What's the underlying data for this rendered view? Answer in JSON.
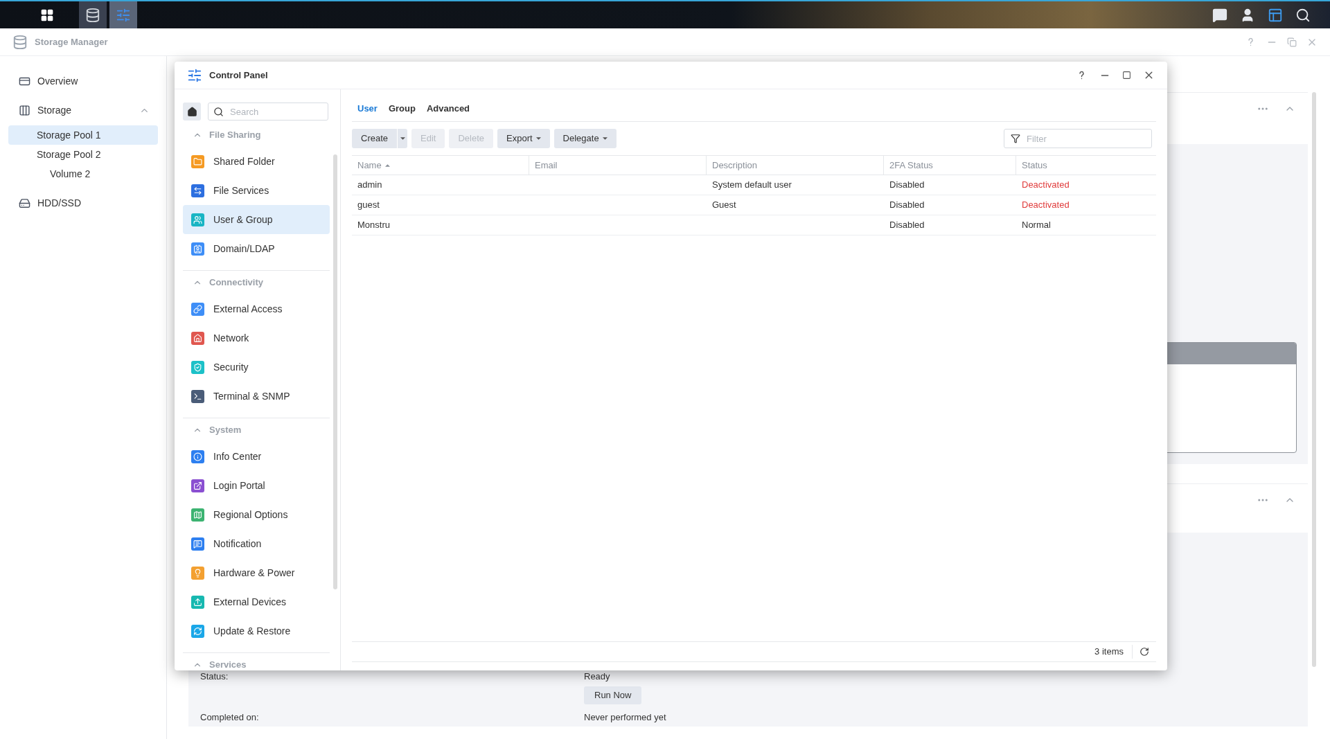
{
  "taskbar": {
    "apps": [
      {
        "selected": false
      },
      {
        "selected": true
      }
    ]
  },
  "storage_manager": {
    "title": "Storage Manager",
    "sidebar": [
      {
        "label": "Overview",
        "selected": false
      },
      {
        "label": "Storage",
        "selected": false,
        "expanded": true,
        "children": [
          {
            "label": "Storage Pool 1",
            "selected": true
          },
          {
            "label": "Storage Pool 2",
            "selected": false,
            "children": [
              {
                "label": "Volume 2",
                "selected": false
              }
            ]
          }
        ]
      },
      {
        "label": "HDD/SSD",
        "selected": false
      }
    ],
    "details": [
      {
        "label": "Status:",
        "value": "Ready",
        "button": "Run Now"
      },
      {
        "label": "Completed on:",
        "value": "Never performed yet"
      }
    ]
  },
  "control_panel": {
    "title": "Control Panel",
    "search": {
      "placeholder": "Search"
    },
    "sections": [
      {
        "title": "File Sharing",
        "expanded": true,
        "items": [
          {
            "label": "Shared Folder",
            "selected": false
          },
          {
            "label": "File Services",
            "selected": false
          },
          {
            "label": "User & Group",
            "selected": true
          },
          {
            "label": "Domain/LDAP",
            "selected": false
          }
        ]
      },
      {
        "title": "Connectivity",
        "expanded": true,
        "items": [
          {
            "label": "External Access",
            "selected": false
          },
          {
            "label": "Network",
            "selected": false
          },
          {
            "label": "Security",
            "selected": false
          },
          {
            "label": "Terminal & SNMP",
            "selected": false
          }
        ]
      },
      {
        "title": "System",
        "expanded": true,
        "items": [
          {
            "label": "Info Center",
            "selected": false
          },
          {
            "label": "Login Portal",
            "selected": false
          },
          {
            "label": "Regional Options",
            "selected": false
          },
          {
            "label": "Notification",
            "selected": false
          },
          {
            "label": "Hardware & Power",
            "selected": false
          },
          {
            "label": "External Devices",
            "selected": false
          },
          {
            "label": "Update & Restore",
            "selected": false
          }
        ]
      },
      {
        "title": "Services",
        "expanded": true
      }
    ],
    "tabs": [
      {
        "label": "User",
        "selected": true
      },
      {
        "label": "Group",
        "selected": false
      },
      {
        "label": "Advanced",
        "selected": false
      }
    ],
    "toolbar": [
      {
        "label": "Create",
        "kind": "split",
        "disabled": false
      },
      {
        "label": "Edit",
        "kind": "plain",
        "disabled": true
      },
      {
        "label": "Delete",
        "kind": "plain",
        "disabled": true
      },
      {
        "label": "Export",
        "kind": "menu",
        "disabled": false
      },
      {
        "label": "Delegate",
        "kind": "menu",
        "disabled": false
      }
    ],
    "filter": {
      "placeholder": "Filter"
    },
    "table": {
      "columns": [
        {
          "label": "Name",
          "sorted": true
        },
        {
          "label": "Email",
          "sorted": false
        },
        {
          "label": "Description",
          "sorted": false
        },
        {
          "label": "2FA Status",
          "sorted": false
        },
        {
          "label": "Status",
          "sorted": false
        }
      ],
      "rows": [
        {
          "cells": [
            "admin",
            "",
            "System default user",
            "Disabled",
            "Deactivated"
          ],
          "warning": true
        },
        {
          "cells": [
            "guest",
            "",
            "Guest",
            "Disabled",
            "Deactivated"
          ],
          "warning": true
        },
        {
          "cells": [
            "Monstru",
            "",
            "",
            "Disabled",
            "Normal"
          ],
          "warning": false
        }
      ]
    },
    "footer": {
      "count": "3 items"
    }
  }
}
